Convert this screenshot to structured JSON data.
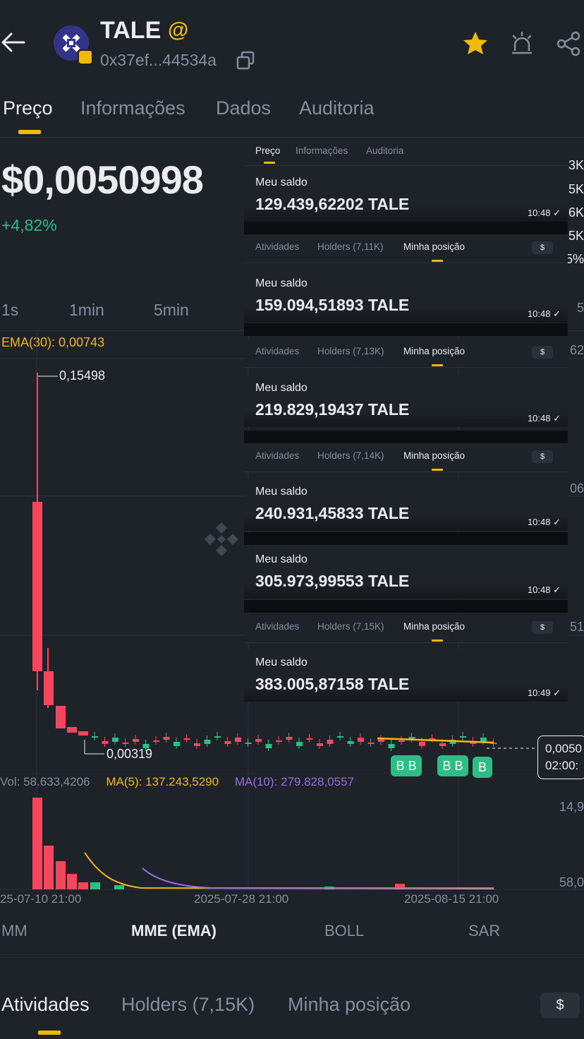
{
  "header": {
    "title": "TALE",
    "at_symbol": "@",
    "address": "0x37ef...44534a"
  },
  "tabs": [
    "Preço",
    "Informações",
    "Dados",
    "Auditoria"
  ],
  "price": "$0,0050998",
  "change": "+4,82%",
  "intervals": [
    "1s",
    "1min",
    "5min"
  ],
  "chart": {
    "ema_label": "EMA(30): 0,00743",
    "high_label": "0,15498",
    "low_label": "0,00319",
    "right_labels": [
      "3K",
      "5K",
      "6K",
      "5K",
      "5%",
      "5",
      "62",
      "06",
      "51"
    ],
    "last_price": "0,0050",
    "countdown": "02:00:",
    "markers": [
      "B",
      "B",
      "B",
      "B",
      "B"
    ],
    "volume": {
      "vol": "Vol: 58.633,4206",
      "ma5": "MA(5): 137.243,5290",
      "ma10": "MA(10): 279.828,0557",
      "right_top": "14,9",
      "right_bottom": "58,0"
    },
    "dates": [
      "25-07-10 21:00",
      "2025-07-28 21:00",
      "2025-08-15 21:00"
    ],
    "colors": {
      "up": "#2ebd85",
      "down": "#f6465d",
      "ema": "#f0b90b",
      "ma10": "#9b6ce0"
    }
  },
  "chart_data": {
    "type": "candlestick",
    "ema_period": 30,
    "high": 0.15498,
    "low": 0.00319,
    "x_ticks": [
      "25-07-10 21:00",
      "2025-07-28 21:00",
      "2025-08-15 21:00"
    ]
  },
  "indicators": [
    "MM",
    "MME (EMA)",
    "BOLL",
    "SAR"
  ],
  "bottom_tabs": [
    "Atividades",
    "Holders (7,15K)",
    "Minha posição"
  ],
  "currency_button": "$",
  "overlay": {
    "first_tabs": [
      "Preço",
      "Informações",
      "Auditoria"
    ],
    "saldo_label": "Meu saldo",
    "mini_tabs": [
      "Atividades",
      "Minha posição"
    ],
    "mini_dollar": "$",
    "cards": [
      {
        "holders": "",
        "value": "129.439,62202 TALE",
        "time": "10:48 ✓"
      },
      {
        "holders": "Holders (7,11K)",
        "value": "159.094,51893 TALE",
        "time": "10:48 ✓"
      },
      {
        "holders": "Holders (7,13K)",
        "value": "219.829,19437 TALE",
        "time": "10:48 ✓"
      },
      {
        "holders": "Holders (7,14K)",
        "value": "240.931,45833 TALE",
        "time": "10:48 ✓"
      },
      {
        "holders": "",
        "value": "305.973,99553 TALE",
        "time": "10:48 ✓"
      },
      {
        "holders": "Holders (7,15K)",
        "value": "383.005,87158 TALE",
        "time": "10:49 ✓"
      }
    ]
  }
}
